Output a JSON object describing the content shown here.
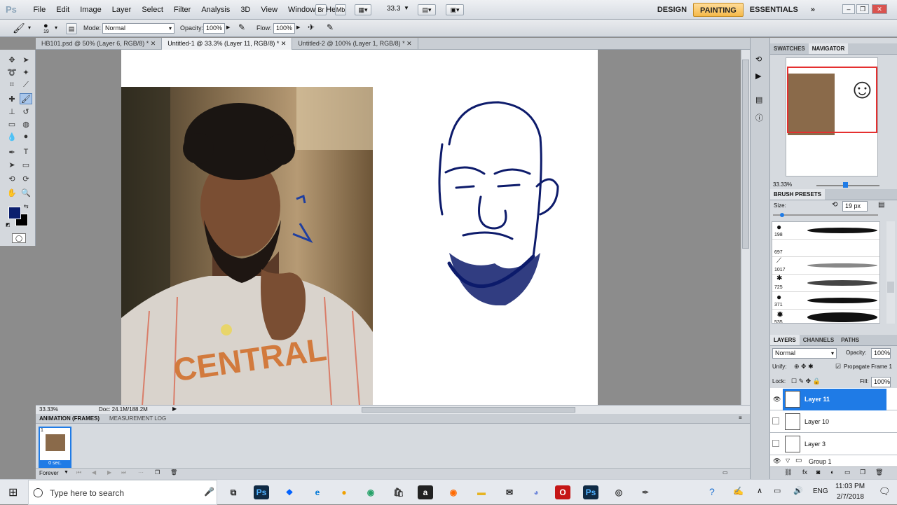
{
  "menubar": {
    "logo": "Ps",
    "menus": [
      "File",
      "Edit",
      "Image",
      "Layer",
      "Select",
      "Filter",
      "Analysis",
      "3D",
      "View",
      "Window",
      "Help"
    ],
    "zoom_value": "33.3",
    "workspaces": [
      "DESIGN",
      "PAINTING",
      "ESSENTIALS"
    ],
    "active_workspace": "PAINTING",
    "more": "»"
  },
  "options": {
    "brush_size": "19",
    "mode_label": "Mode:",
    "mode_value": "Normal",
    "opacity_label": "Opacity:",
    "opacity_value": "100%",
    "flow_label": "Flow:",
    "flow_value": "100%"
  },
  "tabs": [
    {
      "label": "HB101.psd @ 50% (Layer 6, RGB/8) *"
    },
    {
      "label": "Untitled-1 @ 33.3% (Layer 11, RGB/8) *"
    },
    {
      "label": "Untitled-2 @ 100% (Layer 1, RGB/8) *"
    }
  ],
  "status": {
    "zoom": "33.33%",
    "doc": "Doc: 24.1M/188.2M"
  },
  "animation": {
    "tab_animation": "ANIMATION (FRAMES)",
    "tab_measurement": "MEASUREMENT LOG",
    "frame_number": "1",
    "frame_time": "0 sec.",
    "loop": "Forever"
  },
  "navigator": {
    "tab_swatches": "SWATCHES",
    "tab_navigator": "NAVIGATOR",
    "zoom": "33.33%"
  },
  "brush_presets": {
    "title": "BRUSH PRESETS",
    "size_label": "Size:",
    "size_value": "19 px",
    "presets": [
      {
        "num": "198"
      },
      {
        "num": "697"
      },
      {
        "num": "1017"
      },
      {
        "num": "725"
      },
      {
        "num": "371"
      },
      {
        "num": "535"
      }
    ]
  },
  "layers": {
    "tabs": [
      "LAYERS",
      "CHANNELS",
      "PATHS"
    ],
    "blend": "Normal",
    "opacity_label": "Opacity:",
    "opacity_value": "100%",
    "unify_label": "Unify:",
    "propagate_label": "Propagate Frame 1",
    "lock_label": "Lock:",
    "fill_label": "Fill:",
    "fill_value": "100%",
    "items": [
      {
        "name": "Layer 11",
        "selected": true,
        "visible": true
      },
      {
        "name": "Layer 10",
        "selected": false,
        "visible": false
      },
      {
        "name": "Layer 3",
        "selected": false,
        "visible": false
      },
      {
        "name": "Group 1",
        "selected": false,
        "visible": true
      }
    ]
  },
  "taskbar": {
    "search_placeholder": "Type here to search",
    "time": "11:03 PM",
    "date": "2/7/2018",
    "lang": "ENG"
  },
  "colors": {
    "foreground": "#0b1f6e",
    "background": "#000000",
    "accent": "#1f7be6"
  }
}
